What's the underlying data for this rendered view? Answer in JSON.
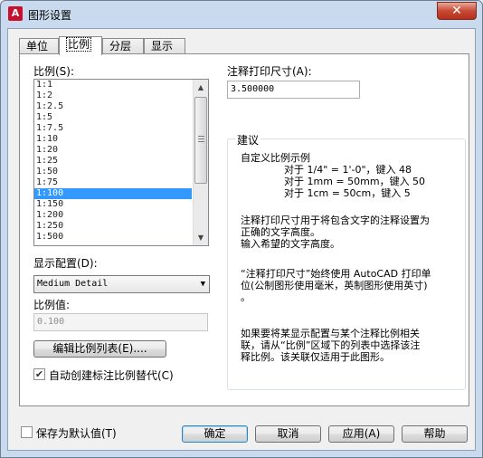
{
  "window": {
    "title": "图形设置",
    "app_icon": "A",
    "close_glyph": "✕"
  },
  "tabs": [
    "单位",
    "比例",
    "分层",
    "显示"
  ],
  "scale": {
    "label": "比例(S):",
    "items": [
      "1:1",
      "1:2",
      "1:2.5",
      "1:5",
      "1:7.5",
      "1:10",
      "1:20",
      "1:25",
      "1:50",
      "1:75",
      "1:100",
      "1:150",
      "1:200",
      "1:250",
      "1:500"
    ],
    "selected": "1:100"
  },
  "display_config": {
    "label": "显示配置(D):",
    "value": "Medium Detail"
  },
  "scale_value": {
    "label": "比例值:",
    "value": "0.100"
  },
  "edit_scale_button": "编辑比例列表(E)....",
  "auto_create_checkbox": {
    "label": "自动创建标注比例替代(C)",
    "checked": true
  },
  "annotation_size": {
    "label": "注释打印尺寸(A):",
    "value": "3.500000"
  },
  "advice": {
    "title": "建议",
    "heading": "自定义比例示例",
    "examples": [
      "对于 1/4\" = 1'-0\"，键入 48",
      "对于 1mm = 50mm，键入 50",
      "对于 1cm = 50cm，键入 5"
    ],
    "para1": "注释打印尺寸用于将包含文字的注释设置为\n正确的文字高度。\n输入希望的文字高度。",
    "para2": "“注释打印尺寸”始终使用 AutoCAD 打印单\n位(公制图形使用毫米，英制图形使用英寸)\n。",
    "para3": "如果要将某显示配置与某个注释比例相关\n联，请从“比例”区域下的列表中选择该注\n释比例。该关联仅适用于此图形。"
  },
  "save_default": {
    "label": "保存为默认值(T)",
    "checked": false
  },
  "buttons": {
    "ok": "确定",
    "cancel": "取消",
    "apply": "应用(A)",
    "help": "帮助"
  }
}
